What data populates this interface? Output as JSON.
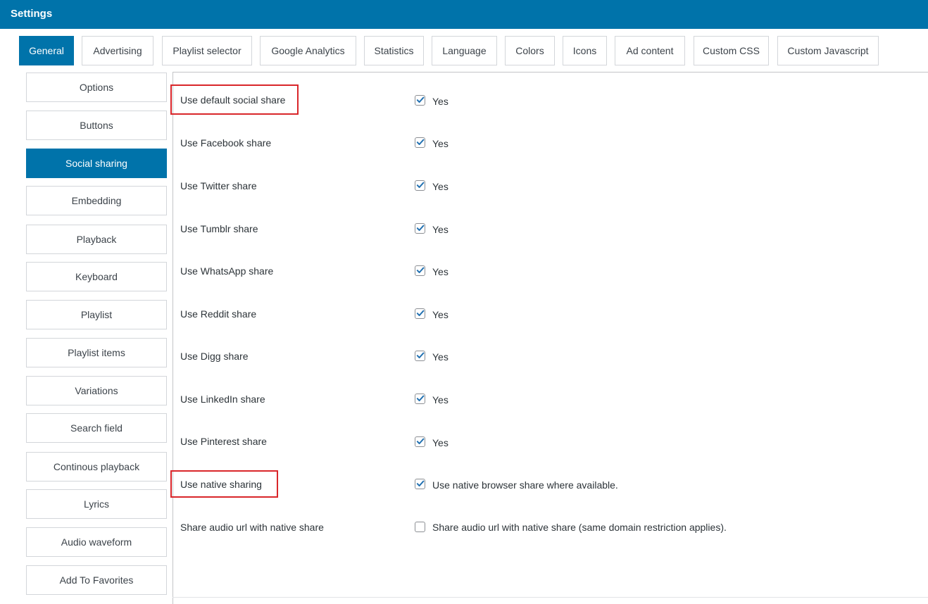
{
  "window": {
    "title": "Settings"
  },
  "tabs": [
    {
      "label": "General",
      "active": true
    },
    {
      "label": "Advertising",
      "active": false
    },
    {
      "label": "Playlist selector",
      "active": false
    },
    {
      "label": "Google Analytics",
      "active": false
    },
    {
      "label": "Statistics",
      "active": false
    },
    {
      "label": "Language",
      "active": false
    },
    {
      "label": "Colors",
      "active": false
    },
    {
      "label": "Icons",
      "active": false
    },
    {
      "label": "Ad content",
      "active": false
    },
    {
      "label": "Custom CSS",
      "active": false
    },
    {
      "label": "Custom Javascript",
      "active": false
    }
  ],
  "sidebar": {
    "items": [
      {
        "label": "Options",
        "active": false
      },
      {
        "label": "Buttons",
        "active": false
      },
      {
        "label": "Social sharing",
        "active": true
      },
      {
        "label": "Embedding",
        "active": false
      },
      {
        "label": "Playback",
        "active": false
      },
      {
        "label": "Keyboard",
        "active": false
      },
      {
        "label": "Playlist",
        "active": false
      },
      {
        "label": "Playlist items",
        "active": false
      },
      {
        "label": "Variations",
        "active": false
      },
      {
        "label": "Search field",
        "active": false
      },
      {
        "label": "Continous playback",
        "active": false
      },
      {
        "label": "Lyrics",
        "active": false
      },
      {
        "label": "Audio waveform",
        "active": false
      },
      {
        "label": "Add To Favorites",
        "active": false
      }
    ]
  },
  "settings": {
    "rows": [
      {
        "label": "Use default social share",
        "checked": true,
        "text": "Yes",
        "highlighted": true
      },
      {
        "label": "Use Facebook share",
        "checked": true,
        "text": "Yes",
        "highlighted": false
      },
      {
        "label": "Use Twitter share",
        "checked": true,
        "text": "Yes",
        "highlighted": false
      },
      {
        "label": "Use Tumblr share",
        "checked": true,
        "text": "Yes",
        "highlighted": false
      },
      {
        "label": "Use WhatsApp share",
        "checked": true,
        "text": "Yes",
        "highlighted": false
      },
      {
        "label": "Use Reddit share",
        "checked": true,
        "text": "Yes",
        "highlighted": false
      },
      {
        "label": "Use Digg share",
        "checked": true,
        "text": "Yes",
        "highlighted": false
      },
      {
        "label": "Use LinkedIn share",
        "checked": true,
        "text": "Yes",
        "highlighted": false
      },
      {
        "label": "Use Pinterest share",
        "checked": true,
        "text": "Yes",
        "highlighted": false
      },
      {
        "label": "Use native sharing",
        "checked": true,
        "text": "Use native browser share where available.",
        "highlighted": true
      },
      {
        "label": "Share audio url with native share",
        "checked": false,
        "text": "Share audio url with native share (same domain restriction applies).",
        "highlighted": false
      }
    ]
  },
  "colors": {
    "accent": "#0073aa",
    "highlight": "#d9262a",
    "check": "#2271b1"
  },
  "icons": {
    "checkbox": "checkmark-icon"
  }
}
